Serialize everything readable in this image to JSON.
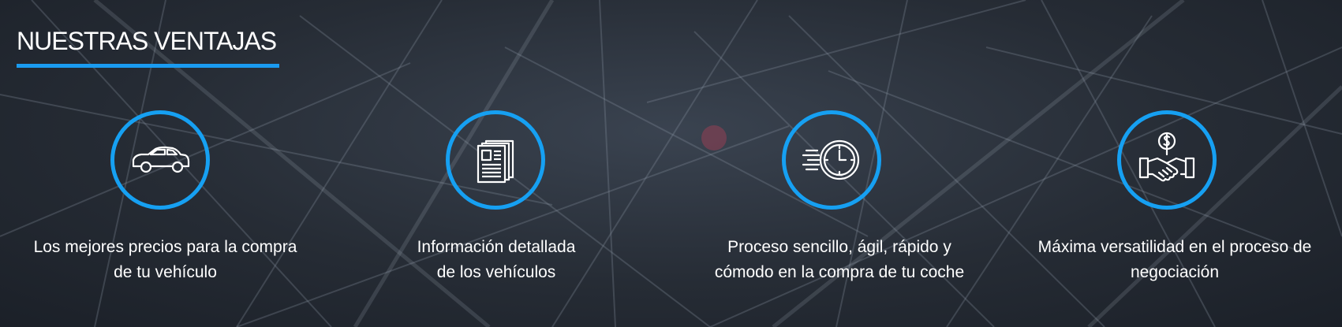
{
  "section": {
    "title": "NUESTRAS VENTAJAS",
    "accent_color": "#1a9bf0"
  },
  "features": [
    {
      "icon": "car-icon",
      "line1": "Los mejores precios para la compra",
      "line2": "de tu vehículo"
    },
    {
      "icon": "newspaper-icon",
      "line1": "Información detallada",
      "line2": "de los vehículos"
    },
    {
      "icon": "fast-clock-icon",
      "line1": "Proceso sencillo, ágil, rápido y",
      "line2": "cómodo en la compra de tu coche"
    },
    {
      "icon": "handshake-dollar-icon",
      "line1": "Máxima versatilidad en el proceso de",
      "line2": "negociación"
    }
  ]
}
